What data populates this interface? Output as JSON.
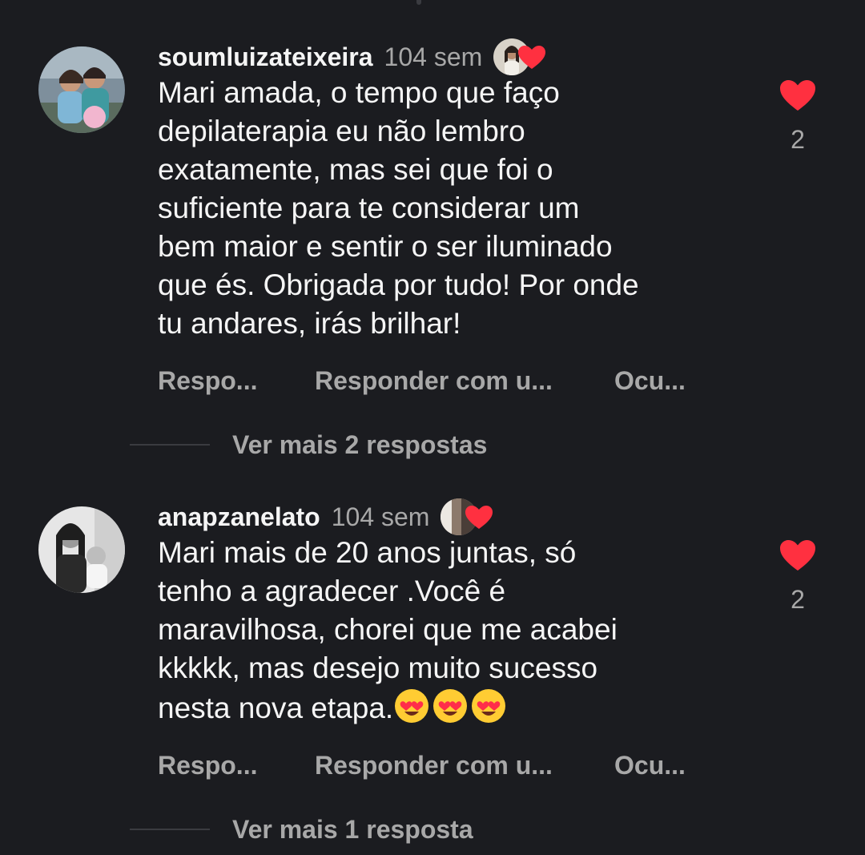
{
  "comments": [
    {
      "username": "soumluizateixeira",
      "time": "104 sem",
      "text_lines": [
        "Mari amada, o tempo que faço",
        "depilaterapia eu não lembro",
        "exatamente, mas sei que foi o",
        "suficiente para te  considerar um",
        "bem  maior e sentir o ser iluminado",
        "que és. Obrigada por tudo! Por onde",
        "tu andares, irás brilhar!"
      ],
      "like_count": "2",
      "actions": {
        "reply": "Respo...",
        "reply_with": "Responder com u...",
        "hide": "Ocu..."
      },
      "view_more": "Ver mais 2 respostas"
    },
    {
      "username": "anapzanelato",
      "time": "104 sem",
      "text_lines": [
        "Mari mais de 20 anos juntas, só",
        "tenho a agradecer .Você é",
        "maravilhosa,  chorei que me acabei",
        "kkkkk, mas desejo muito sucesso",
        "nesta nova etapa."
      ],
      "emoji": "heart-eyes-emoji",
      "like_count": "2",
      "actions": {
        "reply": "Respo...",
        "reply_with": "Responder com u...",
        "hide": "Ocu..."
      },
      "view_more": "Ver mais 1 resposta"
    }
  ],
  "colors": {
    "background": "#1b1c20",
    "text_primary": "#f5f5f5",
    "text_secondary": "#a8a8a8",
    "like_red": "#ff3040"
  },
  "icons": {
    "like": "heart-icon",
    "liked_by": "creator-liked-heart-icon"
  }
}
